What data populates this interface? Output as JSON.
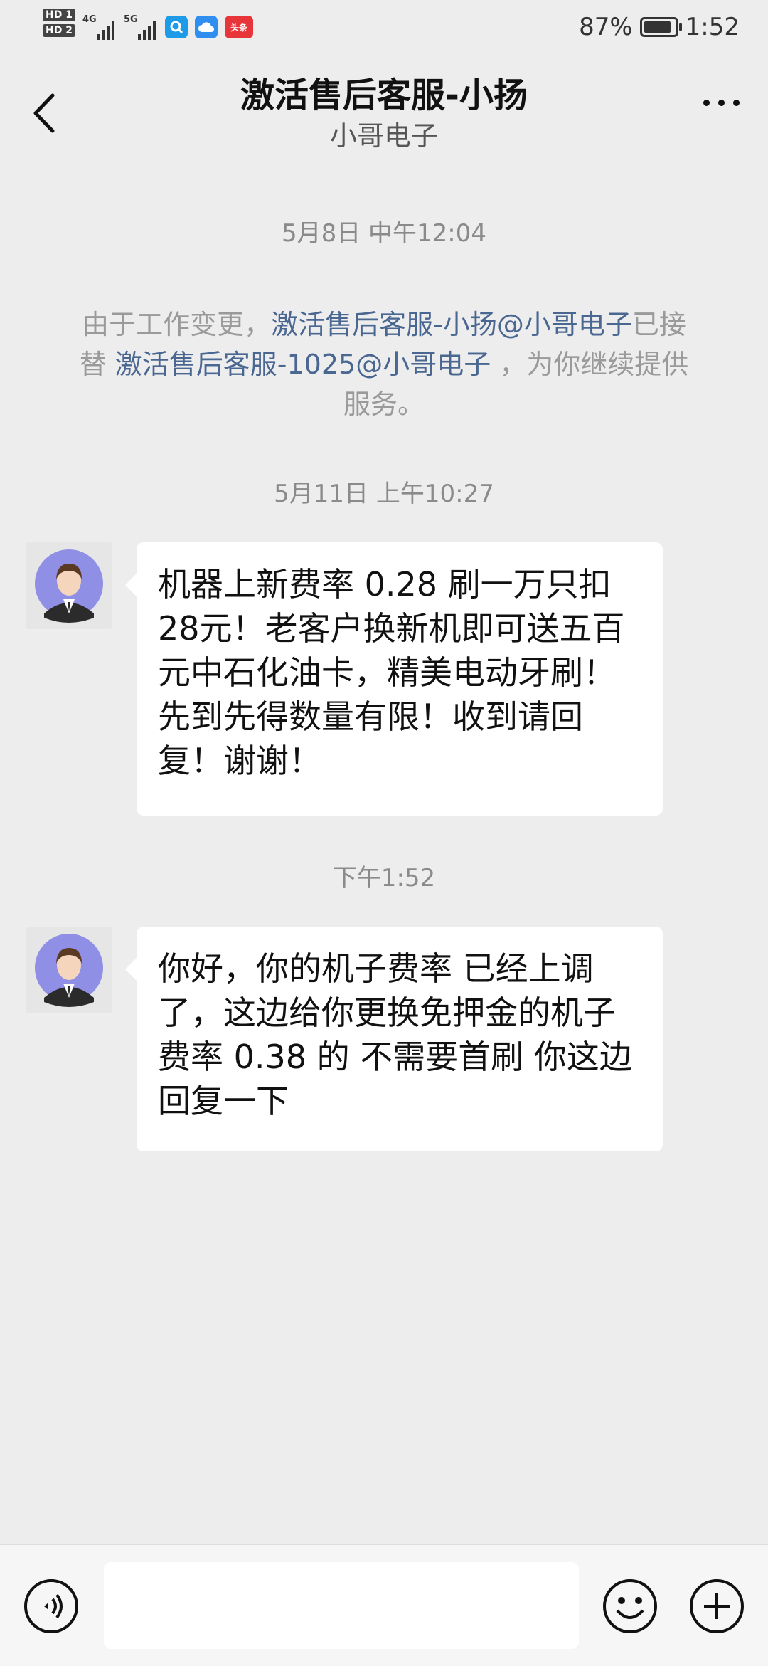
{
  "status_bar": {
    "hd1": "HD 1",
    "hd2": "HD 2",
    "net1": "4G",
    "net2": "5G",
    "app_badge": "头条",
    "battery_text": "87%",
    "battery_level": 0.87,
    "time": "1:52"
  },
  "header": {
    "title": "激活售后客服-小扬",
    "subtitle": "小哥电子"
  },
  "messages": {
    "ts1": "5月8日 中午12:04",
    "system": {
      "part1": "由于工作变更，",
      "agent_new": "激活售后客服-小扬@小哥电子",
      "part2": "已接替",
      "agent_old": "激活售后客服-1025@小哥电子",
      "part3": "，为你继续提供服务。"
    },
    "ts2": "5月11日 上午10:27",
    "msg1": "机器上新费率 0.28 刷一万只扣28元！老客户换新机即可送五百元中石化油卡，精美电动牙刷！先到先得数量有限！收到请回复！谢谢！",
    "ts3": "下午1:52",
    "msg2": "你好，你的机子费率 已经上调了，这边给你更换免押金的机子 费率 0.38 的 不需要首刷 你这边回复一下"
  },
  "input": {
    "value": ""
  },
  "colors": {
    "background": "#ededed",
    "link": "#4a6792",
    "bubble": "#ffffff",
    "avatar_bg": "#8f8fe6"
  },
  "icons": [
    "back-arrow-icon",
    "more-icon",
    "voice-icon",
    "emoji-icon",
    "plus-icon",
    "avatar-icon"
  ]
}
